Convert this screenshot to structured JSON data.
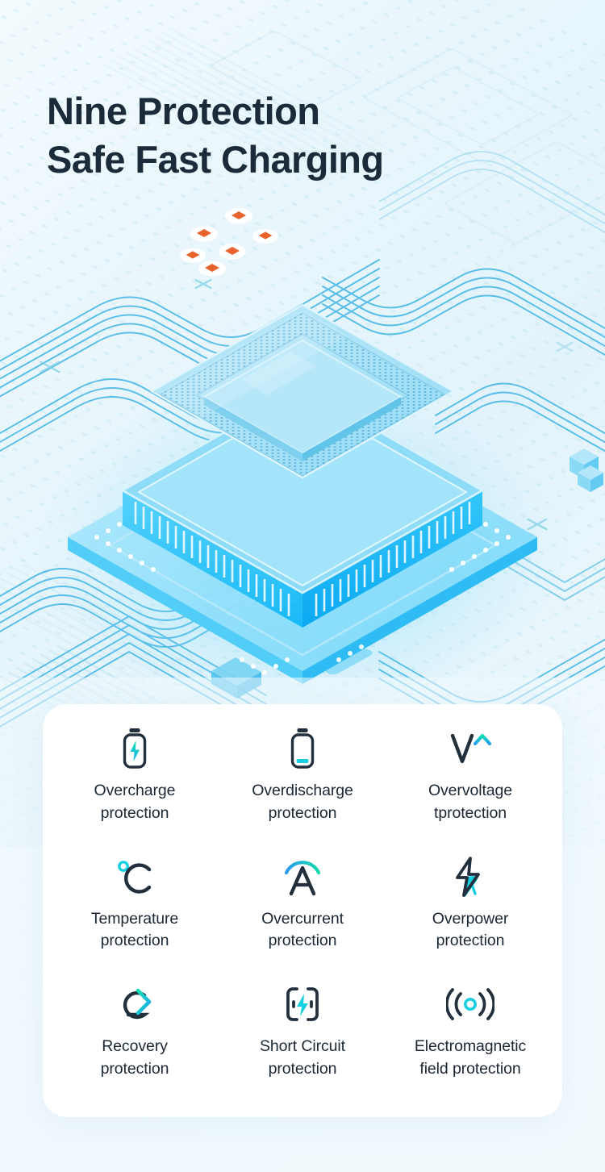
{
  "headline": {
    "line1": "Nine Protection",
    "line2": "Safe Fast Charging",
    "full": "Nine Protection\nSafe Fast Charging"
  },
  "colors": {
    "background": "#eef7fb",
    "heading_text": "#1b2b3a",
    "card_background": "#ffffff",
    "label_text": "#1b2733",
    "icon_dark": "#222f3d",
    "accent_cyan": "#17d9e8",
    "accent_green": "#1fd6a0",
    "accent_blue": "#2b9cf0",
    "component_orange": "#e8622c",
    "trace_blue": "#39b6e8",
    "chip_glow": "#21c7fb"
  },
  "hero": {
    "subject": "isometric-processor-chip-on-circuit-board",
    "components": "orange-smd-components"
  },
  "card": {
    "features": [
      {
        "icon": "battery-charging-icon",
        "label": "Overcharge\nprotection"
      },
      {
        "icon": "battery-low-icon",
        "label": "Overdischarge\nprotection"
      },
      {
        "icon": "voltage-up-arrow-icon",
        "label": "Overvoltage\ntprotection"
      },
      {
        "icon": "celsius-degree-icon",
        "label": "Temperature\nprotection"
      },
      {
        "icon": "ampere-arc-icon",
        "label": "Overcurrent\nprotection"
      },
      {
        "icon": "bolt-ampere-icon",
        "label": "Overpower\nprotection"
      },
      {
        "icon": "recovery-arrow-icon",
        "label": "Recovery\nprotection"
      },
      {
        "icon": "short-circuit-icon",
        "label": "Short Circuit\nprotection"
      },
      {
        "icon": "electromagnetic-wave-icon",
        "label": "Electromagnetic\nfield protection"
      }
    ]
  }
}
